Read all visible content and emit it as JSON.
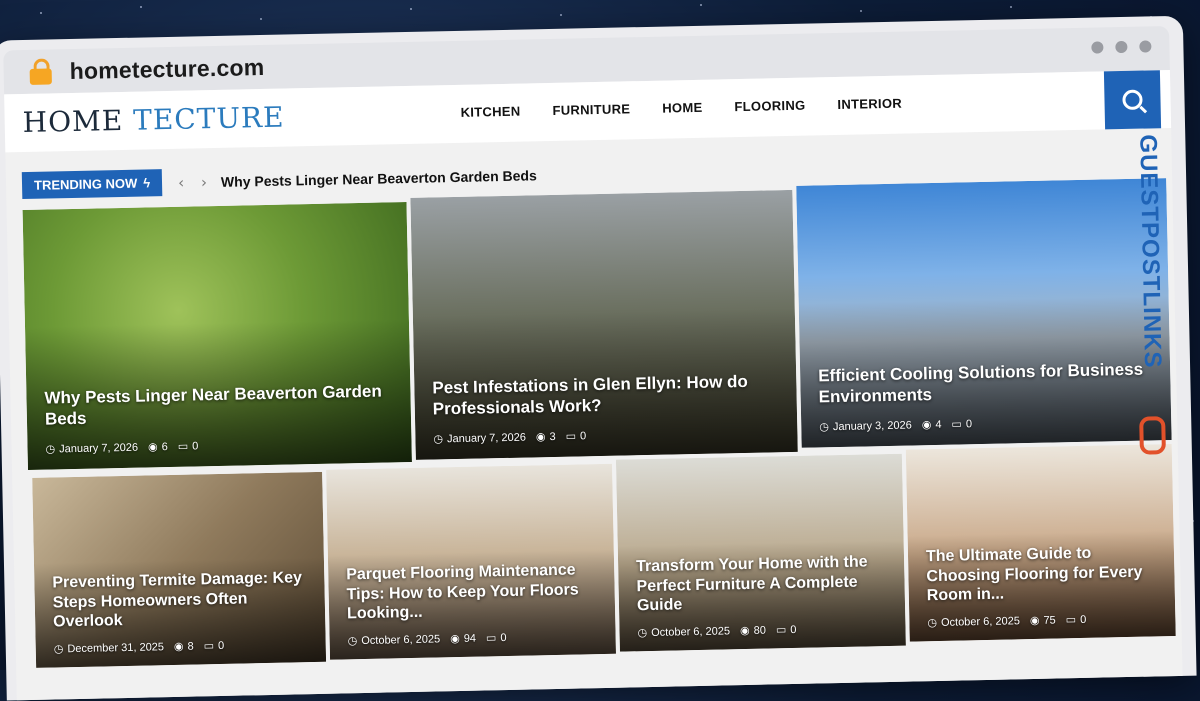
{
  "browser": {
    "url": "hometecture.com"
  },
  "site": {
    "logo_home": "HOME",
    "logo_tecture": "TECTURE",
    "nav": [
      "KITCHEN",
      "FURNITURE",
      "HOME",
      "FLOORING",
      "INTERIOR"
    ]
  },
  "trending": {
    "label": "TRENDING NOW",
    "arrows": "‹ ›",
    "headline": "Why Pests Linger Near Beaverton Garden Beds"
  },
  "featured": [
    {
      "title": "Why Pests Linger Near Beaverton Garden Beds",
      "date": "January 7, 2026",
      "views": "6",
      "comments": "0"
    },
    {
      "title": "Pest Infestations in Glen Ellyn: How do Professionals Work?",
      "date": "January 7, 2026",
      "views": "3",
      "comments": "0"
    },
    {
      "title": "Efficient Cooling Solutions for Business Environments",
      "date": "January 3, 2026",
      "views": "4",
      "comments": "0"
    }
  ],
  "grid": [
    {
      "title": "Preventing Termite Damage: Key Steps Homeowners Often Overlook",
      "date": "December 31, 2025",
      "views": "8",
      "comments": "0"
    },
    {
      "title": "Parquet Flooring Maintenance Tips: How to Keep Your Floors Looking...",
      "date": "October 6, 2025",
      "views": "94",
      "comments": "0"
    },
    {
      "title": "Transform Your Home with the Perfect Furniture A Complete Guide",
      "date": "October 6, 2025",
      "views": "80",
      "comments": "0"
    },
    {
      "title": "The Ultimate Guide to Choosing Flooring for Every Room in...",
      "date": "October 6, 2025",
      "views": "75",
      "comments": "0"
    }
  ],
  "watermark": {
    "text": "GUESTPOSTLINKS"
  },
  "icons": {
    "clock": "clock-icon",
    "eye": "eye-icon",
    "comment": "comment-icon",
    "search": "search-icon",
    "lock": "lock-icon",
    "bolt": "bolt-icon"
  },
  "colors": {
    "accent": "#1f63b6",
    "lock": "#f6a623",
    "watermark_link": "#e2512a"
  }
}
